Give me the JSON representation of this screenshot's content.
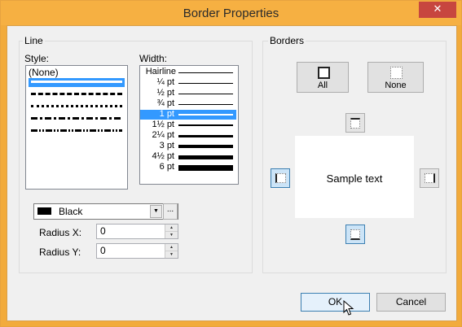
{
  "window": {
    "title": "Border Properties",
    "close_glyph": "✕"
  },
  "line_group": {
    "title": "Line",
    "style_label": "Style:",
    "width_label": "Width:",
    "styles": [
      {
        "label": "(None)"
      },
      {
        "kind": "solid",
        "selected": true
      },
      {
        "kind": "dash"
      },
      {
        "kind": "dot"
      },
      {
        "kind": "dash-dot"
      },
      {
        "kind": "dash-dot-dot"
      }
    ],
    "widths": [
      {
        "label": "Hairline",
        "selected": false
      },
      {
        "label": "¼ pt",
        "selected": false
      },
      {
        "label": "½ pt",
        "selected": false
      },
      {
        "label": "¾ pt",
        "selected": false
      },
      {
        "label": "1 pt",
        "selected": true
      },
      {
        "label": "1½ pt",
        "selected": false
      },
      {
        "label": "2¼ pt",
        "selected": false
      },
      {
        "label": "3 pt",
        "selected": false
      },
      {
        "label": "4½ pt",
        "selected": false
      },
      {
        "label": "6 pt",
        "selected": false
      }
    ],
    "color": {
      "name": "Black",
      "swatch": "#000000"
    },
    "more_colors_label": "...",
    "radius_x": {
      "label": "Radius X:",
      "value": "0"
    },
    "radius_y": {
      "label": "Radius Y:",
      "value": "0"
    }
  },
  "borders_group": {
    "title": "Borders",
    "presets": [
      {
        "label": "All",
        "icon": "box-all-icon"
      },
      {
        "label": "None",
        "icon": "box-none-icon"
      }
    ],
    "sample_text": "Sample text",
    "edges": [
      {
        "name": "top",
        "active": false
      },
      {
        "name": "left",
        "active": true
      },
      {
        "name": "right",
        "active": false
      },
      {
        "name": "bottom",
        "active": true
      }
    ]
  },
  "buttons": {
    "ok": "OK",
    "cancel": "Cancel"
  },
  "colors": {
    "title_bar": "#f6b042",
    "accent": "#3399ff",
    "close": "#c7463f"
  }
}
